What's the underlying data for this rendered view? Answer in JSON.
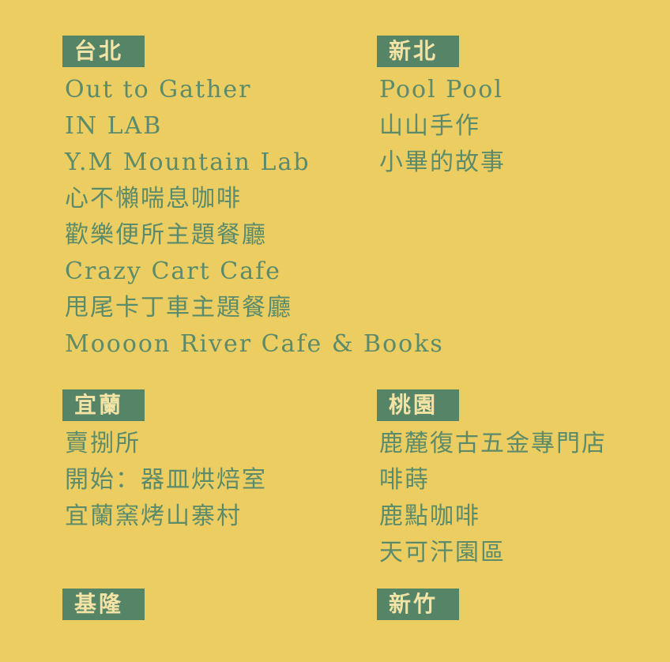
{
  "regions": {
    "taipei": {
      "label": "台北",
      "items": [
        "Out to Gather",
        "IN LAB",
        "Y.M Mountain Lab",
        "心不懶喘息咖啡",
        "歡樂便所主題餐廳",
        "Crazy Cart Cafe",
        "甩尾卡丁車主題餐廳",
        "Moooon River Cafe & Books"
      ]
    },
    "new_taipei": {
      "label": "新北",
      "items": [
        "Pool Pool",
        "山山手作",
        "小畢的故事"
      ]
    },
    "yilan": {
      "label": "宜蘭",
      "items": [
        "賣捌所",
        "開始：器皿烘焙室",
        "宜蘭窯烤山寨村"
      ]
    },
    "taoyuan": {
      "label": "桃園",
      "items": [
        "鹿麓復古五金專門店",
        "啡蒔",
        "鹿點咖啡",
        "天可汗園區"
      ]
    },
    "keelung": {
      "label": "基隆",
      "items": []
    },
    "hsinchu": {
      "label": "新竹",
      "items": []
    }
  },
  "colors": {
    "background": "#ebcd62",
    "badge": "#568466",
    "badge_text": "#f3e3a4",
    "item_text": "#5b8b6b"
  }
}
